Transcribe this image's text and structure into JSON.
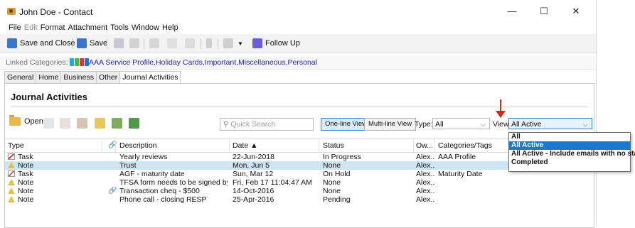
{
  "window": {
    "title": "John Doe - Contact",
    "minimize_glyph": "—",
    "maximize_glyph": "☐",
    "close_glyph": "✕"
  },
  "menu": [
    {
      "label": "File",
      "dim": false
    },
    {
      "label": "Edit",
      "dim": true
    },
    {
      "label": "Format",
      "dim": false
    },
    {
      "label": "Attachment",
      "dim": false
    },
    {
      "label": "Tools",
      "dim": false
    },
    {
      "label": "Window",
      "dim": false
    },
    {
      "label": "Help",
      "dim": false
    }
  ],
  "toolbar": {
    "save_close_label": "Save and Close",
    "save_label": "Save",
    "follow_up_label": "Follow Up",
    "icons": [
      "save-close-icon",
      "save-icon",
      "eraser-icon",
      "delete-icon",
      "scissors-icon",
      "copy-icon",
      "paste-icon",
      "attach-icon",
      "flag-icon",
      "follow-up-icon"
    ]
  },
  "linked": {
    "label": "Linked Categories:",
    "category_colors": [
      "#2ea3d9",
      "#3ebd4a",
      "#e33030",
      "#2a6fd8"
    ],
    "categories": "AAA Service Profile,Holiday Cards,Important,Miscellaneous,Personal"
  },
  "tabs": [
    {
      "label": "General",
      "active": false
    },
    {
      "label": "Home",
      "active": false
    },
    {
      "label": "Business",
      "active": false
    },
    {
      "label": "Other",
      "active": false
    },
    {
      "label": "Journal Activities",
      "active": true
    }
  ],
  "journal": {
    "title": "Journal Activities",
    "open_label": "Open",
    "search_placeholder": "Quick Search",
    "one_line_label": "One-line View",
    "multi_line_label": "Multi-line View",
    "type_label": "Type:",
    "type_value": "All",
    "view_label": "View:",
    "view_value": "All Active",
    "view_options": [
      {
        "label": "All",
        "highlighted": false
      },
      {
        "label": "All Active",
        "highlighted": true
      },
      {
        "label": "All Active - Include emails with no status",
        "highlighted": false
      },
      {
        "label": "Completed",
        "highlighted": false
      }
    ],
    "columns": {
      "type": "Type",
      "description": "Description",
      "date": "Date ▲",
      "status": "Status",
      "owner": "Ow...",
      "categories": "Categories/Tags"
    },
    "rows": [
      {
        "type": "Task",
        "icon": "task-icon",
        "attach": false,
        "description": "Yearly reviews",
        "date": "22-Jun-2018",
        "status": "In Progress",
        "owner": "Alex...",
        "categories": "AAA Profile",
        "selected": false
      },
      {
        "type": "Note",
        "icon": "note-icon",
        "attach": false,
        "description": "Trust",
        "date": "Mon, Jun 5",
        "status": "None",
        "owner": "Alex...",
        "categories": "",
        "selected": true
      },
      {
        "type": "Task",
        "icon": "task-icon",
        "attach": false,
        "description": "AGF - maturity date",
        "date": "Sun, Mar 12",
        "status": "On Hold",
        "owner": "Alex...",
        "categories": "Maturity Date",
        "selected": false
      },
      {
        "type": "Note",
        "icon": "note-icon",
        "attach": false,
        "description": "TFSA form needs to be signed by Pat...",
        "date": "Fri, Feb 17 11:04:47 AM",
        "status": "None",
        "owner": "Alex...",
        "categories": "",
        "selected": false
      },
      {
        "type": "Note",
        "icon": "note-icon",
        "attach": true,
        "description": "Transaction cheq - $500",
        "date": "14-Oct-2016",
        "status": "None",
        "owner": "Alex...",
        "categories": "",
        "selected": false
      },
      {
        "type": "Note",
        "icon": "note-icon",
        "attach": false,
        "description": "Phone call - closing RESP",
        "date": "25-Apr-2016",
        "status": "Pending",
        "owner": "Alex...",
        "categories": "",
        "selected": false
      }
    ]
  },
  "colors": {
    "accent": "#1979cf",
    "selected_row": "#cde6f7",
    "annotation_arrow": "#e2231a",
    "link_text": "#2323c8"
  }
}
